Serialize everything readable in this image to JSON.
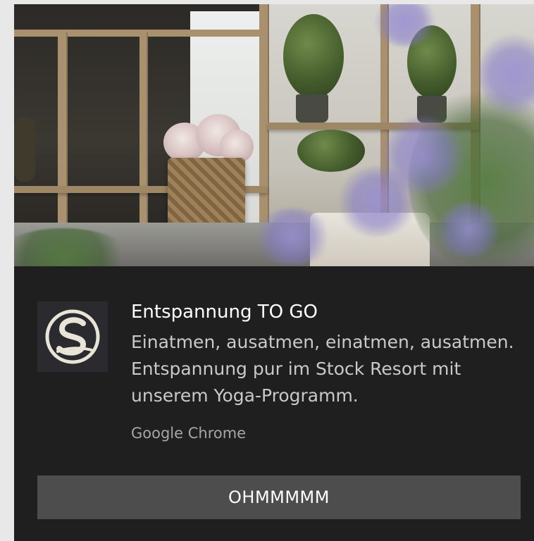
{
  "notification": {
    "title": "Entspannung TO GO",
    "message": "Einatmen, ausatmen, einatmen, ausatmen. Entspannung pur im Stock Resort mit unserem Yoga-Programm.",
    "source": "Google Chrome",
    "action_label": "OHMMMMM",
    "icon": "stock-resort-s-logo",
    "hero_image": "terrace-with-plants-and-lavender"
  },
  "colors": {
    "toast_background": "#1f1f1f",
    "button_background": "#4d4d4d",
    "title_text": "#ffffff",
    "body_text": "#c9c9c9",
    "source_text": "#a6a6a6",
    "logo_background": "#2a2a2f"
  }
}
